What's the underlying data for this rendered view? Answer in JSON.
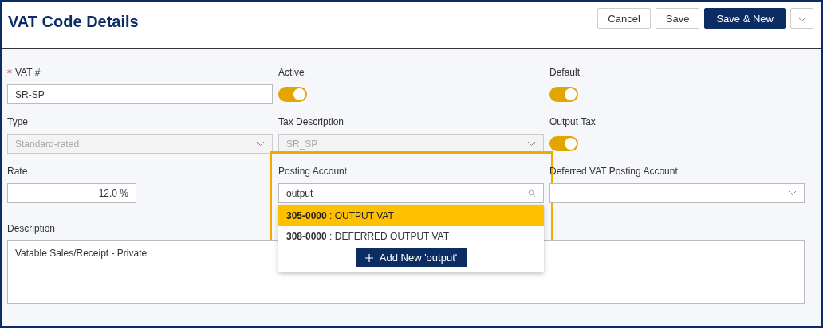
{
  "header": {
    "title": "VAT Code Details",
    "buttons": [
      {
        "label": "Cancel",
        "kind": "secondary"
      },
      {
        "label": "Save",
        "kind": "secondary"
      },
      {
        "label": "Save & New",
        "kind": "primary"
      },
      {
        "kind": "menu"
      }
    ]
  },
  "fields": [
    {
      "kind": "text",
      "label": "VAT #",
      "required": true,
      "value": "SR-SP"
    },
    {
      "kind": "toggle",
      "label": "Active",
      "on": true
    },
    {
      "kind": "toggle",
      "label": "Default",
      "on": true
    },
    {
      "kind": "select",
      "label": "Type",
      "disabled": true,
      "value": "Standard-rated"
    },
    {
      "kind": "select",
      "label": "Tax Description",
      "disabled": true,
      "value": "SR_SP"
    },
    {
      "kind": "toggle",
      "label": "Output Tax",
      "on": true
    },
    {
      "kind": "number",
      "label": "Rate",
      "value": "12.0 %"
    },
    {
      "kind": "search",
      "label": "Posting Account",
      "value": "output",
      "highlighted": true,
      "options": [
        {
          "text": "**305-0000** : OUTPUT VAT",
          "selected": true
        },
        {
          "text": "**308-0000** : DEFERRED OUTPUT VAT",
          "selected": false
        }
      ],
      "add_button": "Add New 'output'"
    },
    {
      "kind": "select",
      "label": "Deferred VAT Posting Account",
      "disabled": false
    },
    {
      "kind": "textarea",
      "label": "Description",
      "value": "Vatable Sales/Receipt - Private"
    }
  ]
}
